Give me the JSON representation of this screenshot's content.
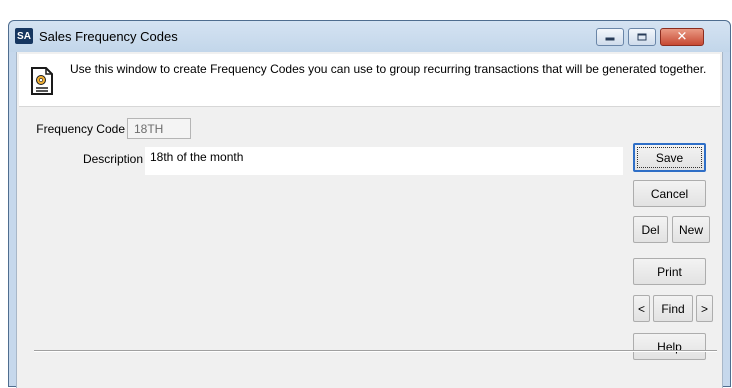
{
  "window": {
    "app_badge": "SA",
    "title": "Sales Frequency Codes",
    "minimize_icon": "minimize-icon",
    "maximize_icon": "maximize-icon",
    "close_icon": "close-icon",
    "close_color": "#c74a33"
  },
  "info": {
    "icon": "document-gear-icon",
    "text": "Use this window to create Frequency Codes you can use to group recurring transactions that will be generated together."
  },
  "form": {
    "frequency_code_label": "Frequency Code",
    "frequency_code_value": "18TH",
    "description_label": "Description",
    "description_value": "18th of the month"
  },
  "buttons": {
    "save": "Save",
    "cancel": "Cancel",
    "del": "Del",
    "new": "New",
    "print": "Print",
    "prev": "<",
    "find": "Find",
    "next": ">",
    "help": "Help"
  },
  "colors": {
    "title_bar": "#c6d8ec",
    "default_button_border": "#2f6fc7"
  }
}
